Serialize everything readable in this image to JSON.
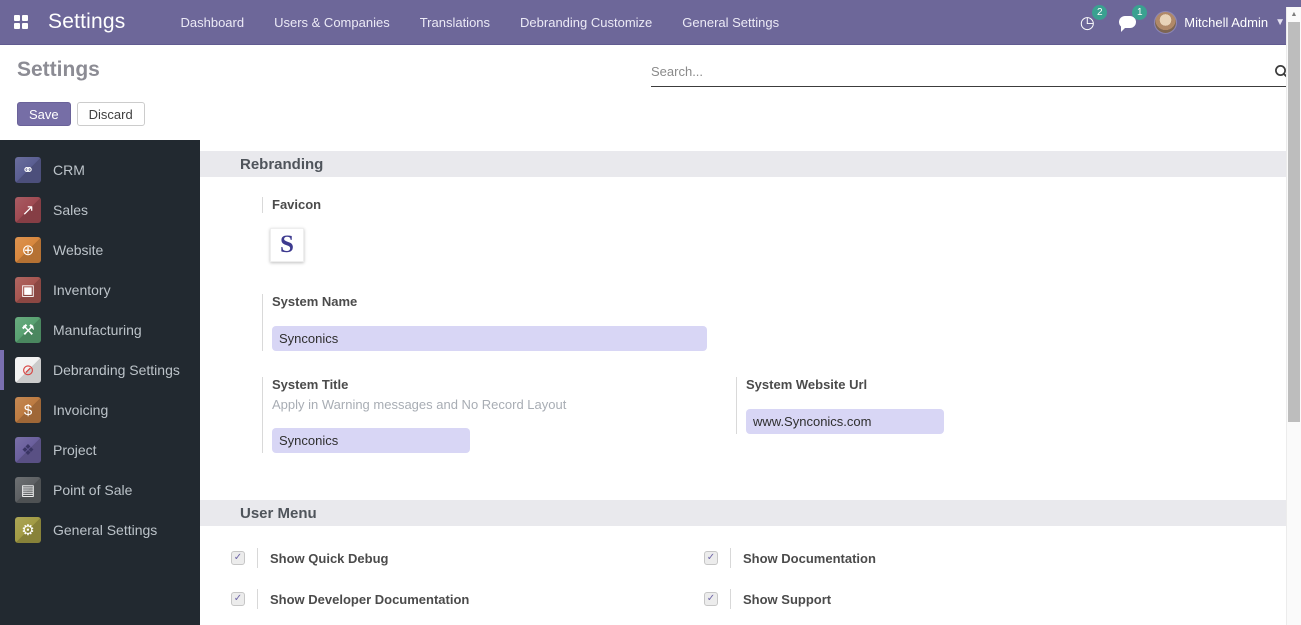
{
  "topbar": {
    "brand": "Settings",
    "nav_items": [
      "Dashboard",
      "Users & Companies",
      "Translations",
      "Debranding Customize",
      "General Settings"
    ],
    "activities": {
      "count": "2"
    },
    "messages": {
      "count": "1"
    },
    "user": {
      "name": "Mitchell Admin"
    },
    "colors": {
      "background": "#6d6799",
      "badge": "#3aa190"
    }
  },
  "control_panel": {
    "page_title": "Settings",
    "search": {
      "placeholder": "Search..."
    },
    "buttons": {
      "save": "Save",
      "discard": "Discard"
    }
  },
  "sidebar": {
    "items": [
      {
        "label": "CRM",
        "glyph": "⚭",
        "color": "#5a5e92",
        "fg": "#ffffff",
        "active": false
      },
      {
        "label": "Sales",
        "glyph": "↗",
        "color": "#9f4a52",
        "fg": "#ffffff",
        "active": false
      },
      {
        "label": "Website",
        "glyph": "⊕",
        "color": "#d8873d",
        "fg": "#ffffff",
        "active": false
      },
      {
        "label": "Inventory",
        "glyph": "▣",
        "color": "#a65550",
        "fg": "#ffffff",
        "active": false
      },
      {
        "label": "Manufacturing",
        "glyph": "⚒",
        "color": "#58a171",
        "fg": "#ffffff",
        "active": false
      },
      {
        "label": "Debranding Settings",
        "glyph": "⊘",
        "color": "#f2f2f2",
        "fg": "#d8423f",
        "active": true
      },
      {
        "label": "Invoicing",
        "glyph": "$",
        "color": "#bd7b41",
        "fg": "#ffffff",
        "active": false
      },
      {
        "label": "Project",
        "glyph": "❖",
        "color": "#6a5f9d",
        "fg": "#3a3564",
        "active": false
      },
      {
        "label": "Point of Sale",
        "glyph": "▤",
        "color": "#5d6063",
        "fg": "#ffffff",
        "active": false
      },
      {
        "label": "General Settings",
        "glyph": "⚙",
        "color": "#a29b44",
        "fg": "#ffffff",
        "active": false
      }
    ]
  },
  "content": {
    "rebranding": {
      "title": "Rebranding",
      "favicon": {
        "label": "Favicon",
        "letter": "S"
      },
      "system_name": {
        "label": "System Name",
        "value": "Synconics"
      },
      "system_title": {
        "label": "System Title",
        "help": "Apply in Warning messages and No Record Layout",
        "value": "Synconics"
      },
      "system_website_url": {
        "label": "System Website Url",
        "value": "www.Synconics.com"
      }
    },
    "user_menu": {
      "title": "User Menu",
      "options": [
        {
          "label": "Show Quick Debug",
          "checked": true
        },
        {
          "label": "Show Documentation",
          "checked": true
        },
        {
          "label": "Show Developer Documentation",
          "checked": true
        },
        {
          "label": "Show Support",
          "checked": true
        }
      ]
    }
  }
}
